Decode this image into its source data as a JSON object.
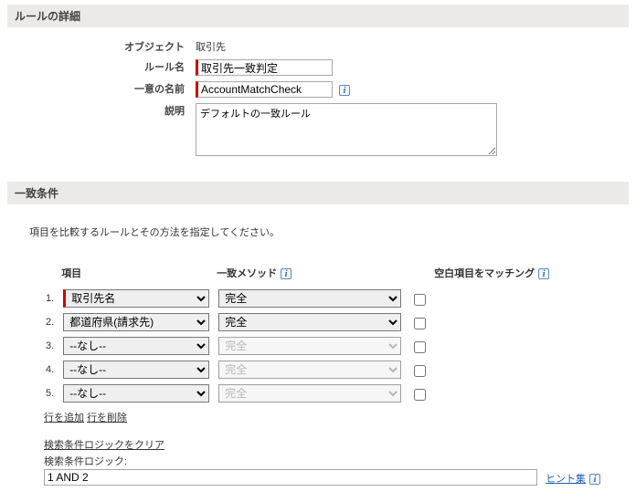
{
  "section1": {
    "title": "ルールの詳細",
    "object_label": "オブジェクト",
    "object_value": "取引先",
    "rule_name_label": "ルール名",
    "rule_name_value": "取引先一致判定",
    "unique_name_label": "一意の名前",
    "unique_name_value": "AccountMatchCheck",
    "description_label": "説明",
    "description_value": "デフォルトの一致ルール"
  },
  "section2": {
    "title": "一致条件",
    "help_text": "項目を比較するルールとその方法を指定してください。",
    "col_field": "項目",
    "col_method": "一致メソッド",
    "col_blank": "空白項目をマッチング",
    "rows": [
      {
        "num": "1.",
        "field": "取引先名",
        "method": "完全",
        "required": true,
        "method_disabled": false,
        "blank": false
      },
      {
        "num": "2.",
        "field": "都道府県(請求先)",
        "method": "完全",
        "required": false,
        "method_disabled": false,
        "blank": false
      },
      {
        "num": "3.",
        "field": "--なし--",
        "method": "完全",
        "required": false,
        "method_disabled": true,
        "blank": false
      },
      {
        "num": "4.",
        "field": "--なし--",
        "method": "完全",
        "required": false,
        "method_disabled": true,
        "blank": false
      },
      {
        "num": "5.",
        "field": "--なし--",
        "method": "完全",
        "required": false,
        "method_disabled": true,
        "blank": false
      }
    ],
    "add_row": "行を追加",
    "del_row": "行を削除",
    "clear_logic": "検索条件ロジックをクリア",
    "logic_label": "検索条件ロジック:",
    "logic_value": "1 AND 2",
    "hint_text": "ヒント集"
  },
  "info_glyph": "i"
}
